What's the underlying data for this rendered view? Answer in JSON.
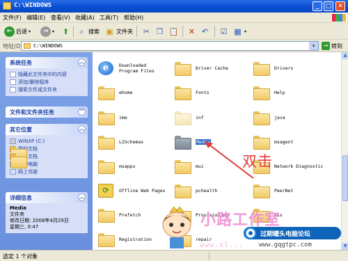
{
  "window": {
    "title": "C:\\WINDOWS",
    "minimize": "_",
    "maximize": "□",
    "close": "✕"
  },
  "menu": [
    "文件(F)",
    "编辑(E)",
    "查看(V)",
    "收藏(A)",
    "工具(T)",
    "帮助(H)"
  ],
  "toolbar": {
    "back_label": "后退",
    "search_label": "搜索",
    "folders_label": "文件夹"
  },
  "address": {
    "label": "地址(D)",
    "value": "C:\\WINDOWS",
    "go_label": "转到"
  },
  "sidebar": {
    "system_tasks": {
      "title": "系统任务",
      "items": [
        "隐藏此文件夹中的内容",
        "添加/删除程序",
        "搜索文件或文件夹"
      ]
    },
    "file_tasks": {
      "title": "文件和文件夹任务"
    },
    "other_places": {
      "title": "其它位置",
      "items": [
        "WINXP (C:)",
        "我的文档",
        "共享文档",
        "我的电脑",
        "网上邻居"
      ]
    },
    "details": {
      "title": "详细信息",
      "name": "Media",
      "type": "文件夹",
      "modified": "修改日期: 2008年4月29日",
      "time": "星期三, 0:47"
    }
  },
  "files": [
    {
      "name": "Downloaded Program Files",
      "icon": "ie-icon"
    },
    {
      "name": "Driver Cache",
      "icon": "folder-icon"
    },
    {
      "name": "Drivers",
      "icon": "folder-icon"
    },
    {
      "name": "ehome",
      "icon": "folder-icon"
    },
    {
      "name": "Fonts",
      "icon": "folder-icon"
    },
    {
      "name": "Help",
      "icon": "folder-icon"
    },
    {
      "name": "ime",
      "icon": "folder-icon"
    },
    {
      "name": "inf",
      "icon": "folder-icon"
    },
    {
      "name": "java",
      "icon": "folder-icon"
    },
    {
      "name": "L2Schemas",
      "icon": "folder-icon"
    },
    {
      "name": "Media",
      "icon": "folder-icon",
      "selected": true
    },
    {
      "name": "msagent",
      "icon": "folder-icon"
    },
    {
      "name": "msapps",
      "icon": "folder-icon"
    },
    {
      "name": "mui",
      "icon": "folder-icon"
    },
    {
      "name": "Network Diagnostic",
      "icon": "folder-icon"
    },
    {
      "name": "Offline Web Pages",
      "icon": "offline-icon"
    },
    {
      "name": "pchealth",
      "icon": "folder-icon"
    },
    {
      "name": "PeerNet",
      "icon": "folder-icon"
    },
    {
      "name": "Prefetch",
      "icon": "folder-icon"
    },
    {
      "name": "Provisioning",
      "icon": "folder-icon"
    },
    {
      "name": "pss",
      "icon": "folder-icon"
    },
    {
      "name": "Registration",
      "icon": "folder-icon"
    },
    {
      "name": "repair",
      "icon": "folder-icon"
    }
  ],
  "status": {
    "text": "选定 1 个对象"
  },
  "annotation": {
    "text": "双击"
  },
  "watermark": {
    "brand": "小路工作室",
    "site_title": "过期罐头电脑论坛",
    "url": "www.gqgtpc.com",
    "url_faint": "www.xl..."
  },
  "colors": {
    "titlebar": "#0a4fd6",
    "taskpane": "#6a8fde",
    "selection": "#316ac5",
    "annotation": "#e23a3a",
    "watermark_pink": "#f08ed6"
  }
}
